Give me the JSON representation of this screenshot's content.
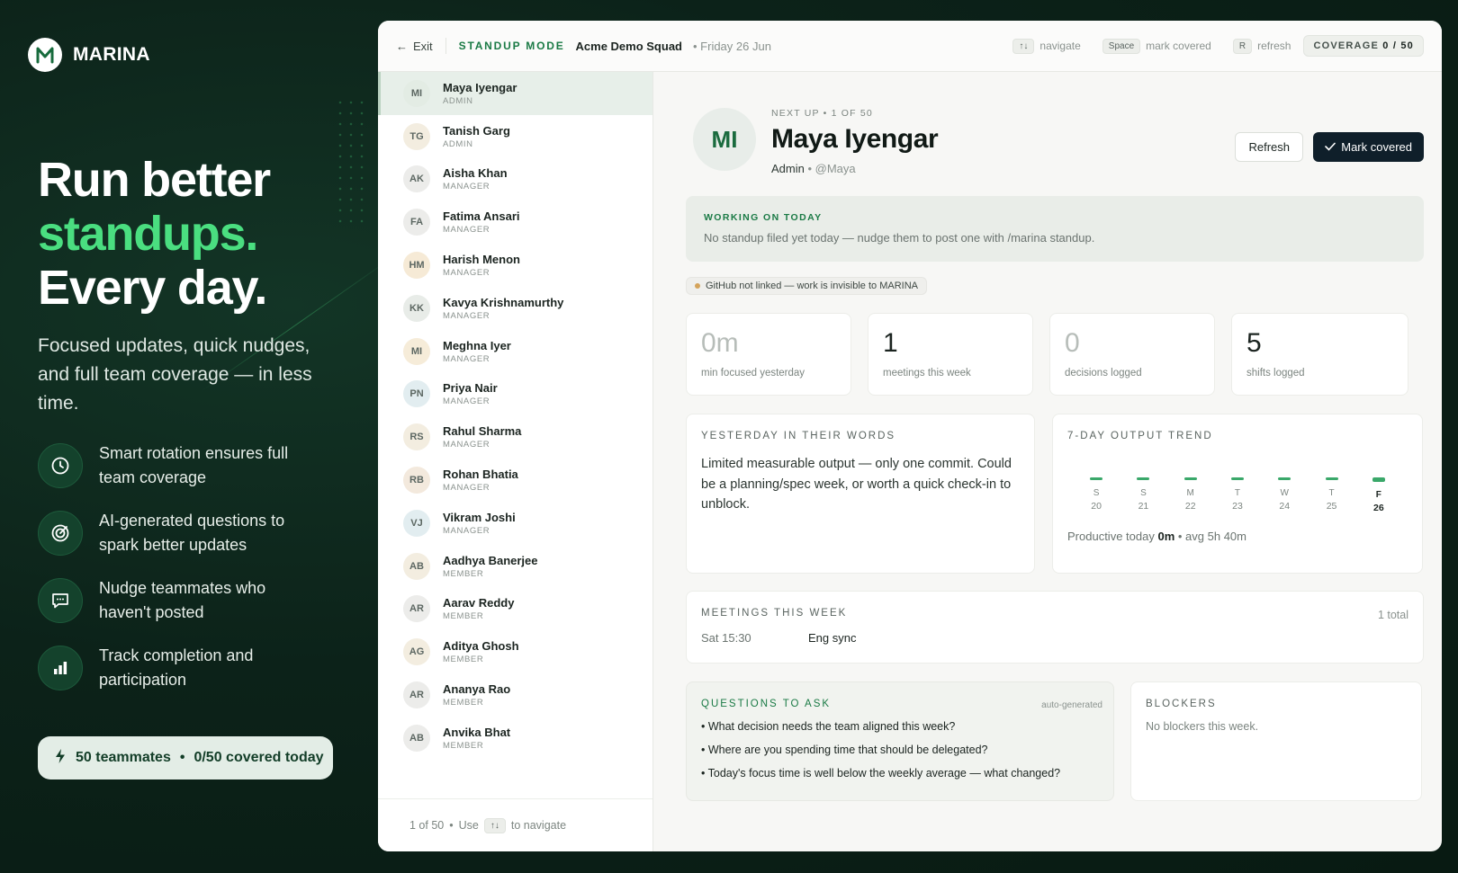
{
  "brand": {
    "name": "MARINA",
    "logo_letter": "M"
  },
  "hero": {
    "line1": "Run better",
    "line2": "standups.",
    "line3": "Every day."
  },
  "subtitle": "Focused updates, quick nudges, and full team coverage — in less time.",
  "features": [
    {
      "icon": "clock-icon",
      "text": "Smart rotation ensures full team coverage"
    },
    {
      "icon": "target-icon",
      "text": "AI-generated questions to spark better updates"
    },
    {
      "icon": "chat-bubble-icon",
      "text": "Nudge teammates who haven't posted"
    },
    {
      "icon": "bar-chart-icon",
      "text": "Track completion and participation"
    }
  ],
  "summary_pill": {
    "teammates": "50 teammates",
    "covered": "0/50 covered today"
  },
  "topbar": {
    "exit_label": "Exit",
    "mode": "STANDUP MODE",
    "squad": "Acme Demo Squad",
    "date": "Friday 26 Jun",
    "shortcuts": [
      {
        "key": "↑↓",
        "label": "navigate"
      },
      {
        "key": "Space",
        "label": "mark covered"
      },
      {
        "key": "R",
        "label": "refresh"
      }
    ],
    "coverage_label": "COVERAGE",
    "coverage_value": "0 / 50"
  },
  "members": [
    {
      "initials": "MI",
      "name": "Maya Iyengar",
      "role": "ADMIN",
      "color": "#e3ece4"
    },
    {
      "initials": "TG",
      "name": "Tanish Garg",
      "role": "ADMIN",
      "color": "#f3ede0"
    },
    {
      "initials": "AK",
      "name": "Aisha Khan",
      "role": "MANAGER",
      "color": "#ececea"
    },
    {
      "initials": "FA",
      "name": "Fatima Ansari",
      "role": "MANAGER",
      "color": "#ececea"
    },
    {
      "initials": "HM",
      "name": "Harish Menon",
      "role": "MANAGER",
      "color": "#f6ead6"
    },
    {
      "initials": "KK",
      "name": "Kavya Krishnamurthy",
      "role": "MANAGER",
      "color": "#e8ece8"
    },
    {
      "initials": "MI",
      "name": "Meghna Iyer",
      "role": "MANAGER",
      "color": "#f6ecd9"
    },
    {
      "initials": "PN",
      "name": "Priya Nair",
      "role": "MANAGER",
      "color": "#e2edf0"
    },
    {
      "initials": "RS",
      "name": "Rahul Sharma",
      "role": "MANAGER",
      "color": "#f3ede0"
    },
    {
      "initials": "RB",
      "name": "Rohan Bhatia",
      "role": "MANAGER",
      "color": "#f3e9dd"
    },
    {
      "initials": "VJ",
      "name": "Vikram Joshi",
      "role": "MANAGER",
      "color": "#e2edf0"
    },
    {
      "initials": "AB",
      "name": "Aadhya Banerjee",
      "role": "MEMBER",
      "color": "#f3ede0"
    },
    {
      "initials": "AR",
      "name": "Aarav Reddy",
      "role": "MEMBER",
      "color": "#ececea"
    },
    {
      "initials": "AG",
      "name": "Aditya Ghosh",
      "role": "MEMBER",
      "color": "#f3ede0"
    },
    {
      "initials": "AR",
      "name": "Ananya Rao",
      "role": "MEMBER",
      "color": "#ececea"
    },
    {
      "initials": "AB",
      "name": "Anvika Bhat",
      "role": "MEMBER",
      "color": "#ececea"
    }
  ],
  "sidebar_footer": {
    "position": "1 of 50",
    "use": "Use",
    "key": "↑↓",
    "hint": "to navigate"
  },
  "profile": {
    "initials": "MI",
    "next_up": "NEXT UP • 1 OF 50",
    "name": "Maya Iyengar",
    "role": "Admin",
    "handle": "@Maya",
    "refresh_label": "Refresh",
    "mark_label": "Mark covered"
  },
  "working": {
    "label": "WORKING ON TODAY",
    "text": "No standup filed yet today — nudge them to post one with /marina standup."
  },
  "github_notice": "GitHub not linked — work is invisible to MARINA",
  "stats": [
    {
      "value": "0m",
      "label": "min focused yesterday"
    },
    {
      "value": "1",
      "label": "meetings this week"
    },
    {
      "value": "0",
      "label": "decisions logged"
    },
    {
      "value": "5",
      "label": "shifts logged"
    }
  ],
  "yesterday": {
    "label": "YESTERDAY IN THEIR WORDS",
    "text": "Limited measurable output — only one commit. Could be a planning/spec week, or worth a quick check-in to unblock."
  },
  "trend": {
    "label": "7-DAY OUTPUT TREND",
    "days": [
      {
        "letter": "S",
        "num": "20"
      },
      {
        "letter": "S",
        "num": "21"
      },
      {
        "letter": "M",
        "num": "22"
      },
      {
        "letter": "T",
        "num": "23"
      },
      {
        "letter": "W",
        "num": "24"
      },
      {
        "letter": "T",
        "num": "25"
      },
      {
        "letter": "F",
        "num": "26"
      }
    ],
    "productive_label": "Productive today",
    "productive_value": "0m",
    "avg": "avg 5h 40m"
  },
  "meetings": {
    "label": "MEETINGS THIS WEEK",
    "total": "1 total",
    "items": [
      {
        "time": "Sat 15:30",
        "title": "Eng sync"
      }
    ]
  },
  "questions": {
    "label": "QUESTIONS TO ASK",
    "tag": "auto-generated",
    "items": [
      "What decision needs the team aligned this week?",
      "Where are you spending time that should be delegated?",
      "Today's focus time is well below the weekly average — what changed?"
    ]
  },
  "blockers": {
    "label": "BLOCKERS",
    "text": "No blockers this week."
  }
}
